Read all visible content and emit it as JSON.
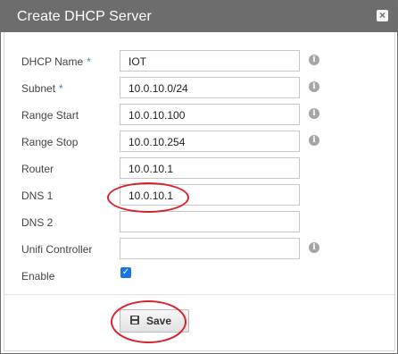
{
  "dialog": {
    "title": "Create DHCP Server",
    "close_icon": "close-icon"
  },
  "form": {
    "fields": [
      {
        "label": "DHCP Name",
        "required": "*",
        "value": "IOT",
        "info": "i"
      },
      {
        "label": "Subnet",
        "required": "*",
        "value": "10.0.10.0/24",
        "info": "i"
      },
      {
        "label": "Range Start",
        "value": "10.0.10.100",
        "info": "i"
      },
      {
        "label": "Range Stop",
        "value": "10.0.10.254",
        "info": "i"
      },
      {
        "label": "Router",
        "value": "10.0.10.1"
      },
      {
        "label": "DNS 1",
        "value": "10.0.10.1"
      },
      {
        "label": "DNS 2",
        "value": ""
      },
      {
        "label": "Unifi Controller",
        "value": "",
        "info": "i"
      }
    ],
    "enable": {
      "label": "Enable",
      "checked": true,
      "check_glyph": "✓"
    }
  },
  "footer": {
    "save_label": "Save",
    "save_icon": "floppy-disk-icon"
  },
  "annotations": {
    "color": "#d8232a",
    "highlighted": [
      "dns1-value",
      "save-button"
    ]
  },
  "colors": {
    "titlebar": "#6d6d6d",
    "required_marker": "#3a85c6",
    "checkbox": "#1a73e8"
  }
}
